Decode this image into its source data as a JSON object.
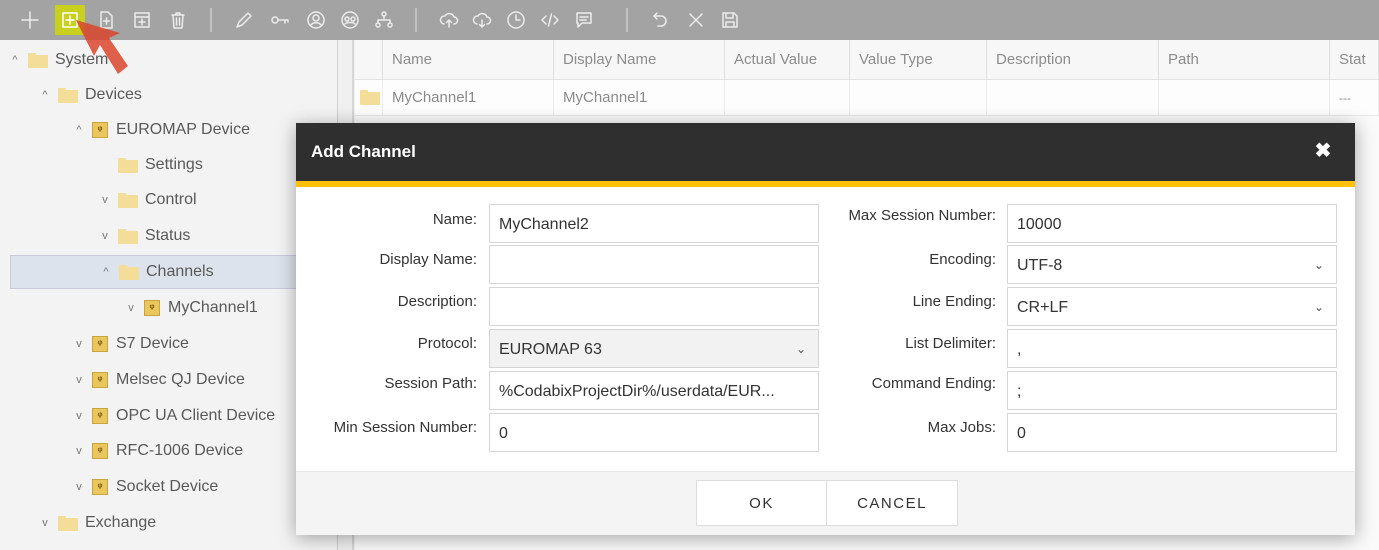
{
  "toolbar": {
    "icons": [
      "plus-icon",
      "add-folder-icon",
      "add-file-icon",
      "add-item-icon",
      "trash-icon",
      "pencil-icon",
      "key-icon",
      "user-circle-icon",
      "group-icon",
      "hierarchy-icon",
      "cloud-upload-icon",
      "cloud-download-icon",
      "clock-icon",
      "code-icon",
      "comment-icon",
      "undo-icon",
      "close-icon",
      "save-icon"
    ],
    "accent": "#c7cf1f"
  },
  "tree": {
    "items": [
      {
        "label": "System",
        "chevron": "^"
      },
      {
        "label": "Devices",
        "chevron": "^"
      },
      {
        "label": "EUROMAP Device",
        "chevron": "^"
      },
      {
        "label": "Settings",
        "chevron": ""
      },
      {
        "label": "Control",
        "chevron": "v"
      },
      {
        "label": "Status",
        "chevron": "v"
      },
      {
        "label": "Channels",
        "chevron": "^"
      },
      {
        "label": "MyChannel1",
        "chevron": "v"
      },
      {
        "label": "S7 Device",
        "chevron": "v"
      },
      {
        "label": "Melsec QJ Device",
        "chevron": "v"
      },
      {
        "label": "OPC UA Client Device",
        "chevron": "v"
      },
      {
        "label": "RFC-1006 Device",
        "chevron": "v"
      },
      {
        "label": "Socket Device",
        "chevron": "v"
      },
      {
        "label": "Exchange",
        "chevron": "v"
      }
    ]
  },
  "table": {
    "columns": [
      "Name",
      "Display Name",
      "Actual Value",
      "Value Type",
      "Description",
      "Path",
      "Stat"
    ],
    "rows": [
      {
        "name": "MyChannel1",
        "display_name": "MyChannel1",
        "status": "---"
      }
    ]
  },
  "dialog": {
    "title": "Add Channel",
    "close": "✖",
    "fields": {
      "name": {
        "label": "Name:",
        "value": "MyChannel2"
      },
      "display_name": {
        "label": "Display Name:",
        "value": ""
      },
      "description": {
        "label": "Description:",
        "value": ""
      },
      "protocol": {
        "label": "Protocol:",
        "value": "EUROMAP 63"
      },
      "session_path": {
        "label": "Session Path:",
        "value": "%CodabixProjectDir%/userdata/EUR..."
      },
      "min_session": {
        "label": "Min Session Number:",
        "value": "0"
      },
      "max_session": {
        "label": "Max Session Number:",
        "value": "10000"
      },
      "encoding": {
        "label": "Encoding:",
        "value": "UTF-8"
      },
      "line_ending": {
        "label": "Line Ending:",
        "value": "CR+LF"
      },
      "list_delimiter": {
        "label": "List Delimiter:",
        "value": ","
      },
      "command_ending": {
        "label": "Command Ending:",
        "value": ";"
      },
      "max_jobs": {
        "label": "Max Jobs:",
        "value": "0"
      }
    },
    "ok": "OK",
    "cancel": "CANCEL",
    "accent": "#ffc107"
  }
}
